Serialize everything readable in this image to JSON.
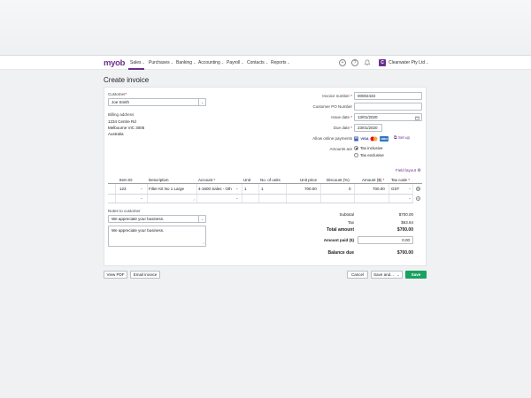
{
  "app": {
    "logo": "myob",
    "brand_color": "#6b2f8f",
    "save_color": "#1aa160"
  },
  "nav": {
    "items": [
      {
        "label": "Sales"
      },
      {
        "label": "Purchases"
      },
      {
        "label": "Banking"
      },
      {
        "label": "Accounting"
      },
      {
        "label": "Payroll"
      },
      {
        "label": "Contacts"
      },
      {
        "label": "Reports"
      }
    ],
    "company_initial": "C",
    "company_name": "Clearwater Pty Ltd"
  },
  "page": {
    "title": "Create invoice"
  },
  "customer": {
    "label": "Customer",
    "value": "Joe Smith",
    "billing_label": "Billing address",
    "address_line1": "1234 Centre Rd",
    "address_line2": "Melbourne VIC 3006",
    "address_line3": "Australia"
  },
  "invoice": {
    "number_label": "Invoice number",
    "number": "00002433",
    "po_label": "Customer PO Number",
    "po": "",
    "issue_label": "Issue date",
    "issue_date": "13/01/2020",
    "due_label": "Due date",
    "due_date": "23/01/2020",
    "online_label": "Allow online payments",
    "setup_label": "Set up",
    "amounts_label": "Amounts are",
    "tax_inclusive": "Tax inclusive",
    "tax_exclusive": "Tax exclusive",
    "selected_tax": "Tax inclusive"
  },
  "payment_logos": [
    "VISA",
    "MC",
    "AMEX"
  ],
  "field_layout": "Field layout",
  "table": {
    "headers": [
      "Item ID",
      "Description",
      "Account",
      "Unit",
      "No. of units",
      "Unit price",
      "Discount (%)",
      "Amount ($)",
      "Tax code"
    ],
    "row": {
      "item_id": "123",
      "description": "Filter Kit No 1 Large",
      "account": "4-1600 Sales - Oth",
      "unit": "1",
      "units": "1",
      "unit_price": "700.00",
      "discount": "0",
      "amount": "700.00",
      "tax_code": "GST"
    }
  },
  "notes": {
    "label": "Notes to customer",
    "select_value": "We appreciate your business.",
    "text": "We appreciate your business."
  },
  "totals": {
    "subtotal_label": "Subtotal",
    "subtotal": "$700.00",
    "tax_label": "Tax",
    "tax": "$63.64",
    "total_label": "Total amount",
    "total": "$700.00",
    "paid_label": "Amount paid ($)",
    "paid": "0.00",
    "balance_label": "Balance due",
    "balance": "$700.00"
  },
  "buttons": {
    "view_pdf": "View PDF",
    "email_invoice": "Email invoice",
    "cancel": "Cancel",
    "save_and": "Save and...",
    "save": "Save"
  }
}
